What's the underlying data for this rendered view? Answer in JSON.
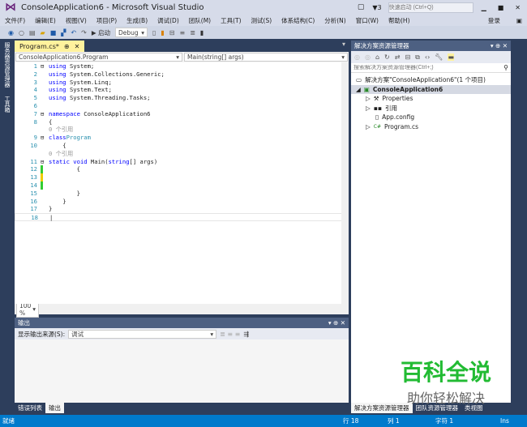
{
  "title": "ConsoleApplication6 - Microsoft Visual Studio",
  "notif_count": "3",
  "quick_launch_placeholder": "快速启动 (Ctrl+Q)",
  "signin": "登录",
  "menu": [
    "文件(F)",
    "编辑(E)",
    "视图(V)",
    "项目(P)",
    "生成(B)",
    "调试(D)",
    "团队(M)",
    "工具(T)",
    "测试(S)",
    "体系结构(C)",
    "分析(N)",
    "窗口(W)",
    "帮助(H)"
  ],
  "toolbar": {
    "start": "▶ 启动",
    "config": "Debug"
  },
  "left_tabs": [
    "服务器资源管理器",
    "工具箱"
  ],
  "doc_tab": "Program.cs*",
  "nav": {
    "class": "ConsoleApplication6.Program",
    "member": "Main(string[] args)"
  },
  "code": {
    "zoom": "100 %",
    "refs": "0 个引用"
  },
  "output": {
    "title": "输出",
    "source_label": "显示输出来源(S):",
    "source": "调试"
  },
  "bottom_tabs": [
    "错误列表",
    "输出"
  ],
  "solution": {
    "title": "解决方案资源管理器",
    "search_placeholder": "搜索解决方案资源管理器(Ctrl+;)",
    "root": "解决方案\"ConsoleApplication6\"(1 个项目)",
    "project": "ConsoleApplication6",
    "items": [
      "Properties",
      "引用",
      "App.config",
      "Program.cs"
    ],
    "tabs": [
      "解决方案资源管理器",
      "团队资源管理器",
      "类视图"
    ]
  },
  "status": {
    "ready": "就绪",
    "line": "行 18",
    "col": "列 1",
    "char": "字符 1",
    "mode": "Ins"
  },
  "watermark": {
    "main": "百科全说",
    "sub": "助你轻松解决"
  }
}
